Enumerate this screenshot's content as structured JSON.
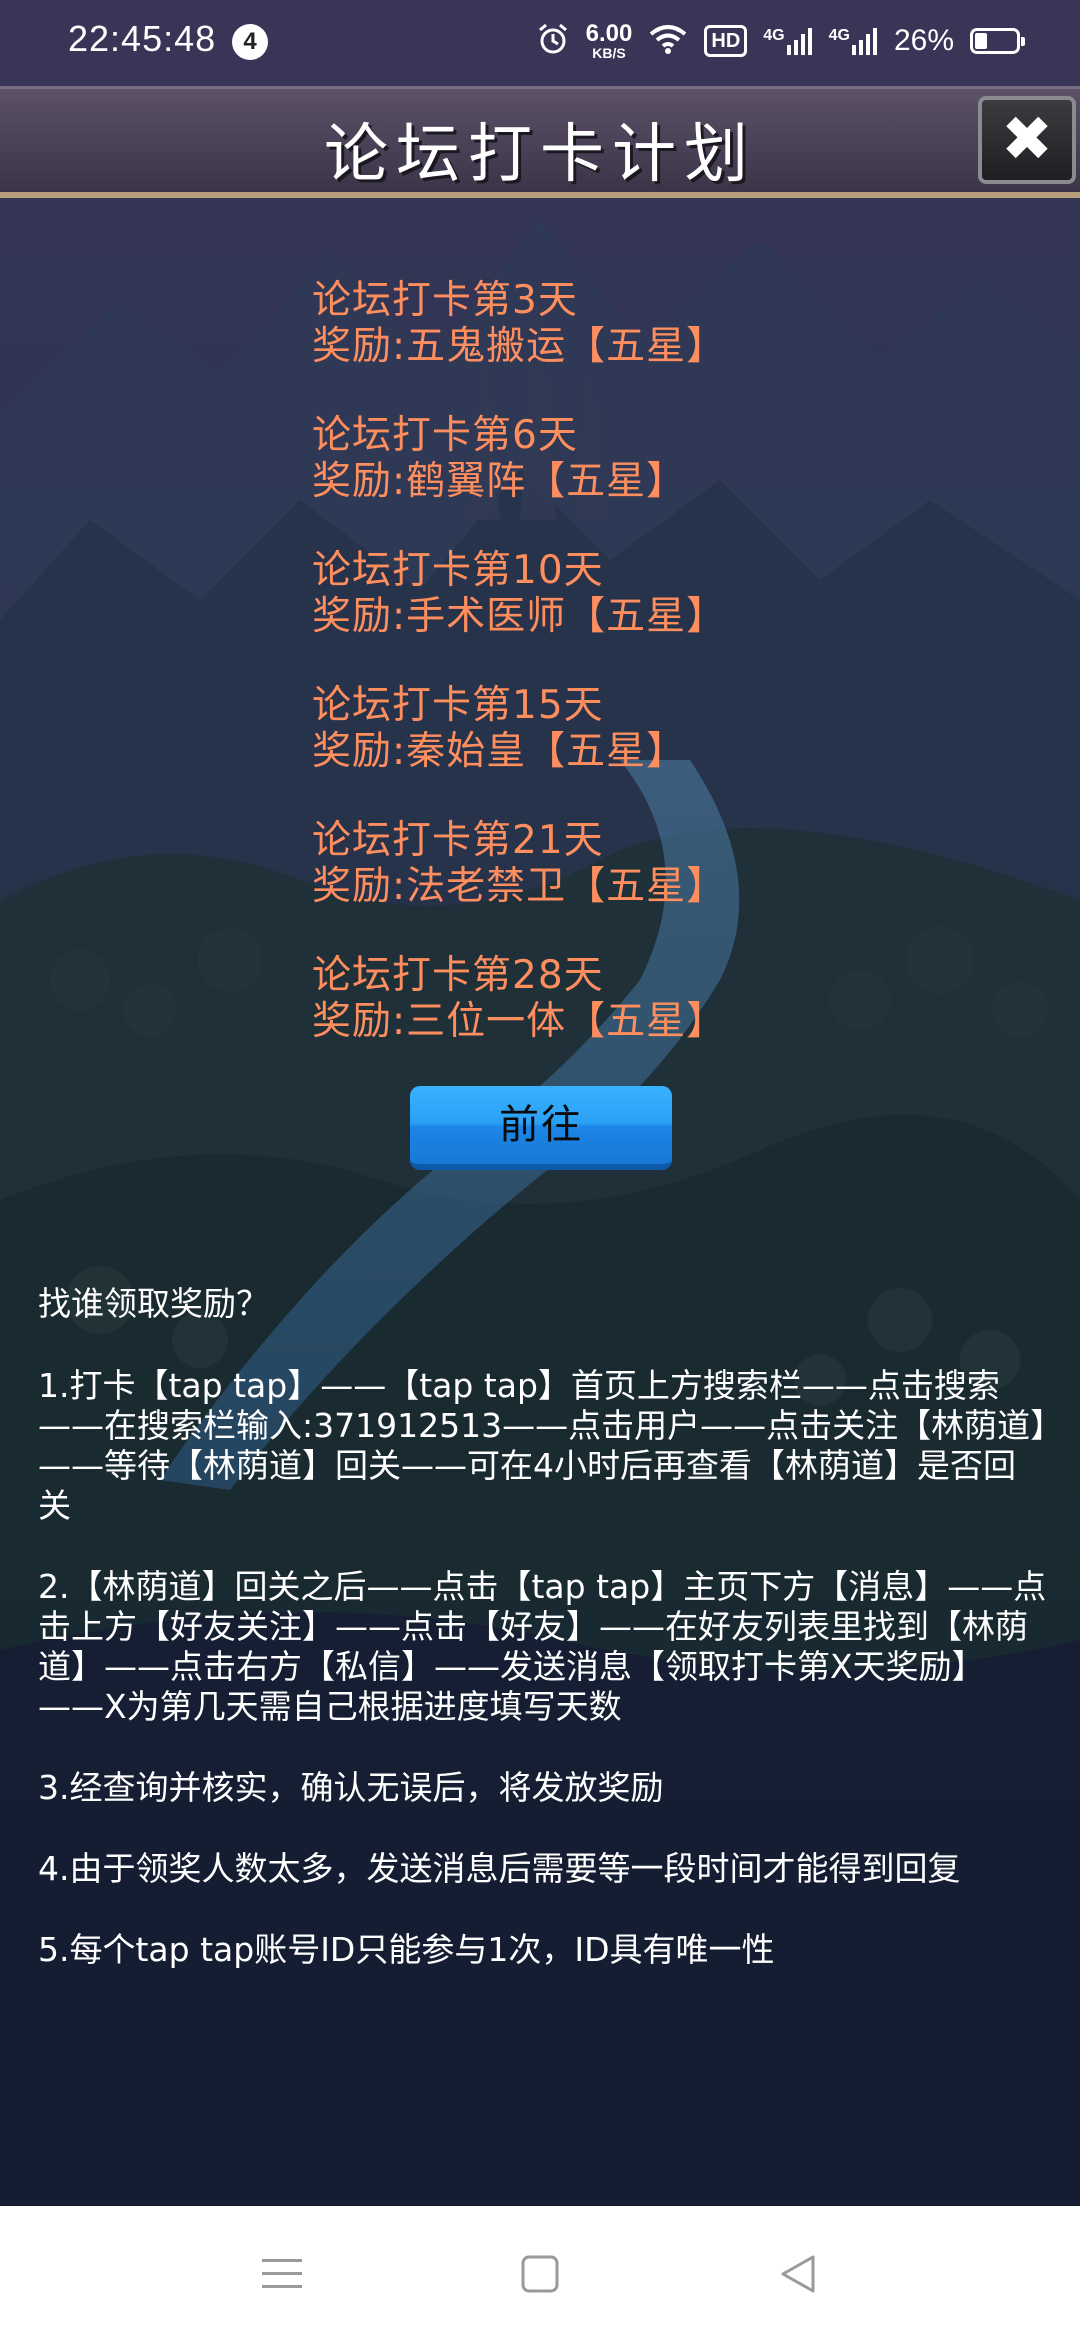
{
  "status_bar": {
    "time": "22:45:48",
    "notification_count": "4",
    "net_speed_value": "6.00",
    "net_speed_unit": "KB/S",
    "hd_label": "HD",
    "signal_1": "4G",
    "signal_2": "4G",
    "battery_percent": "26%"
  },
  "header": {
    "title": "论坛打卡计划",
    "close_symbol": "✖"
  },
  "rewards": [
    {
      "day_text": "论坛打卡第3天",
      "reward_text": "奖励:五鬼搬运【五星】"
    },
    {
      "day_text": "论坛打卡第6天",
      "reward_text": "奖励:鹤翼阵【五星】"
    },
    {
      "day_text": "论坛打卡第10天",
      "reward_text": "奖励:手术医师【五星】"
    },
    {
      "day_text": "论坛打卡第15天",
      "reward_text": "奖励:秦始皇【五星】"
    },
    {
      "day_text": "论坛打卡第21天",
      "reward_text": "奖励:法老禁卫【五星】"
    },
    {
      "day_text": "论坛打卡第28天",
      "reward_text": "奖励:三位一体【五星】"
    }
  ],
  "go_button": {
    "label": "前往"
  },
  "instructions": {
    "question": "找谁领取奖励？",
    "steps": [
      "1.打卡【tap tap】——【tap tap】首页上方搜索栏——点击搜索——在搜索栏输入:371912513——点击用户——点击关注【林荫道】——等待【林荫道】回关——可在4小时后再查看【林荫道】是否回关",
      "2.【林荫道】回关之后——点击【tap tap】主页下方【消息】——点击上方【好友关注】——点击【好友】——在好友列表里找到【林荫道】——点击右方【私信】——发送消息【领取打卡第X天奖励】——X为第几天需自己根据进度填写天数",
      "3.经查询并核实，确认无误后，将发放奖励",
      "4.由于领奖人数太多，发送消息后需要等一段时间才能得到回复",
      "5.每个tap tap账号ID只能参与1次，ID具有唯一性"
    ]
  },
  "colors": {
    "reward_text": "#ff8e5e",
    "go_button": "#2aa0f5",
    "title_bar": "#4a4157",
    "background": "#1d2a3b"
  },
  "nav_bar": {
    "icons": [
      "menu-icon",
      "home-square-icon",
      "back-triangle-icon"
    ]
  }
}
